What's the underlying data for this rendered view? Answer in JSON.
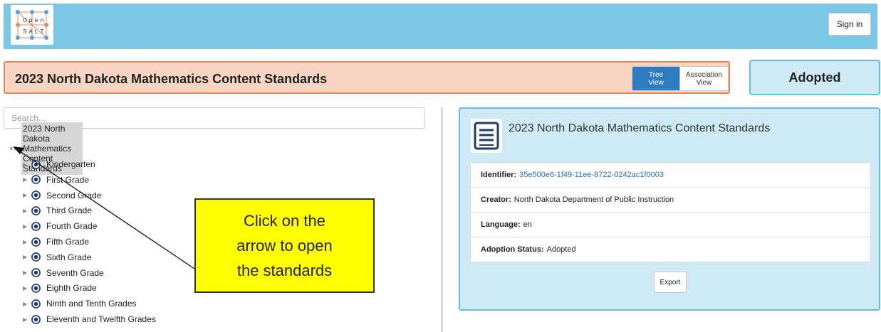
{
  "header": {
    "logo_letters": [
      "O",
      "p",
      "e",
      "n",
      "S",
      "A",
      "L",
      "T"
    ],
    "signin_label": "Sign in"
  },
  "document": {
    "title": "2023 North Dakota Mathematics Content Standards",
    "view_toggle": {
      "tree_label": "Tree\nView",
      "association_label": "Association\nView",
      "active": "tree"
    },
    "status": "Adopted"
  },
  "search": {
    "placeholder": "Search..."
  },
  "tree": {
    "root_label": "2023 North Dakota Mathematics Content Standards",
    "children": [
      "Kindergarten",
      "First Grade",
      "Second Grade",
      "Third Grade",
      "Fourth Grade",
      "Fifth Grade",
      "Sixth Grade",
      "Seventh Grade",
      "Eighth Grade",
      "Ninth and Tenth Grades",
      "Eleventh and Twelfth Grades"
    ]
  },
  "details": {
    "title": "2023 North Dakota Mathematics Content Standards",
    "identifier_label": "Identifier:",
    "identifier_value": "35e500e6-1f49-11ee-8722-0242ac1f0003",
    "creator_label": "Creator:",
    "creator_value": "North Dakota Department of Public Instruction",
    "language_label": "Language:",
    "language_value": "en",
    "adoption_label": "Adoption Status:",
    "adoption_value": "Adopted",
    "export_label": "Export"
  },
  "callout": {
    "line1": "Click on the",
    "line2": "arrow to open",
    "line3": "the standards"
  },
  "colors": {
    "header_bg": "#7ac7e6",
    "title_bg": "#f8d5c2",
    "title_border": "#e58a55",
    "panel_bg": "#cdeaf5",
    "panel_border": "#6bbbe0",
    "toggle_active": "#2f7bbf",
    "callout_bg": "#ffff00",
    "radio_icon": "#1e3a6e"
  },
  "icons": {
    "tree_arrow": "triangle-icon",
    "document": "document-icon",
    "item": "target-radio-icon"
  }
}
